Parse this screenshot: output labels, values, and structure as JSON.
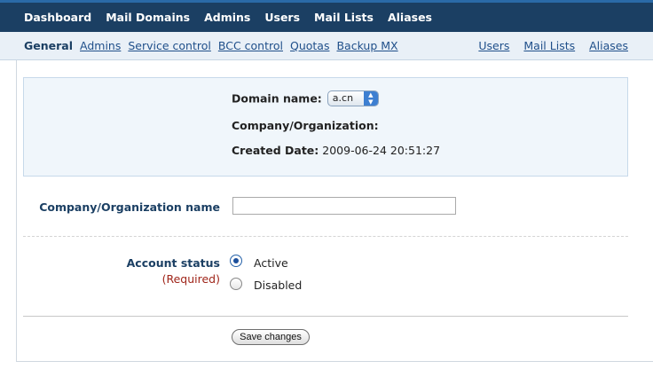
{
  "topnav": [
    "Dashboard",
    "Mail Domains",
    "Admins",
    "Users",
    "Mail Lists",
    "Aliases"
  ],
  "subnav": {
    "active": "General",
    "left": [
      "Admins",
      "Service control",
      "BCC control",
      "Quotas",
      "Backup MX"
    ],
    "right": [
      "Users",
      "Mail Lists",
      "Aliases"
    ]
  },
  "info": {
    "domain_label": "Domain name:",
    "domain_value": "a.cn",
    "company_label": "Company/Organization:",
    "created_label": "Created Date:",
    "created_value": "2009-06-24 20:51:27"
  },
  "form": {
    "company_name_label": "Company/Organization name",
    "company_name_value": "",
    "account_status_label": "Account status",
    "required_text": "(Required)",
    "status_options": [
      {
        "label": "Active",
        "selected": true
      },
      {
        "label": "Disabled",
        "selected": false
      }
    ],
    "save_label": "Save changes"
  },
  "colors": {
    "topbar": "#1b3f63",
    "link": "#1f4f8a",
    "required": "#a0261b"
  }
}
